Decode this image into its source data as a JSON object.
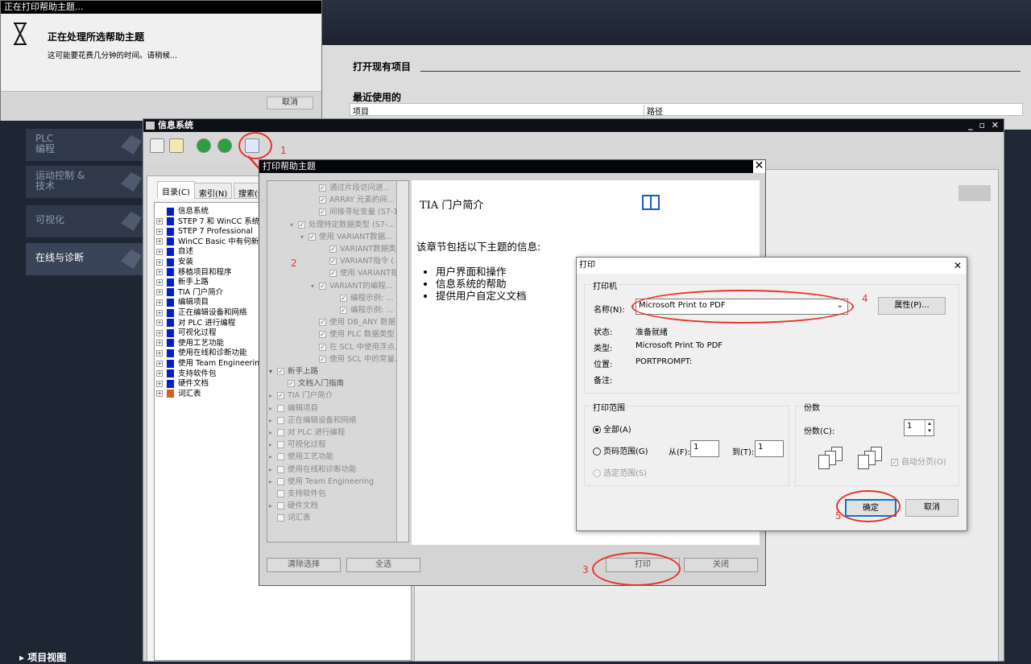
{
  "busy_dialog": {
    "title": "正在打印帮助主题...",
    "heading": "正在处理所选帮助主题",
    "message": "这可能要花费几分钟的时间。请稍候...",
    "cancel": "取消"
  },
  "tia": {
    "nav": [
      {
        "label": "PLC\n编程"
      },
      {
        "label": "运动控制 &\n技术"
      },
      {
        "label": "可视化"
      },
      {
        "label": "在线与诊断"
      }
    ],
    "project_view": "▸ 项目视图",
    "open_project": "打开现有项目",
    "recent": "最近使用的",
    "col_project": "项目",
    "col_path": "路径"
  },
  "info": {
    "title": "信息系统",
    "win_ctrl": "_ ▫ ✕",
    "tabs": [
      "目录(C)",
      "索引(N)",
      "搜索(S"
    ],
    "tree": [
      {
        "label": "信息系统",
        "top": true
      },
      {
        "label": "STEP 7 和 WinCC 系统"
      },
      {
        "label": "STEP 7 Professional"
      },
      {
        "label": "WinCC Basic 中有何新"
      },
      {
        "label": "自述"
      },
      {
        "label": "安装"
      },
      {
        "label": "移植项目和程序"
      },
      {
        "label": "新手上路"
      },
      {
        "label": "TIA 门户简介"
      },
      {
        "label": "编辑项目"
      },
      {
        "label": "正在编辑设备和网络"
      },
      {
        "label": "对 PLC 进行编程"
      },
      {
        "label": "可视化过程"
      },
      {
        "label": "使用工艺功能"
      },
      {
        "label": "使用在线和诊断功能"
      },
      {
        "label": "使用 Team Engineerin"
      },
      {
        "label": "支持软件包"
      },
      {
        "label": "硬件文档"
      },
      {
        "label": "词汇表"
      }
    ]
  },
  "print_help": {
    "title": "打印帮助主题",
    "tree": [
      {
        "label": "通过片段访问进...",
        "ind": 4
      },
      {
        "label": "ARRAY 元素的间...",
        "ind": 4
      },
      {
        "label": "间接寻址变量 (S7-1...",
        "ind": 4
      },
      {
        "label": "处理特定数据类型 (S7-...",
        "ind": 2,
        "arrow": "▾"
      },
      {
        "label": "使用 VARIANT数据...",
        "ind": 3,
        "arrow": "▾"
      },
      {
        "label": "VARIANT数据类...",
        "ind": 5
      },
      {
        "label": "VARIANT指令 (...",
        "ind": 5
      },
      {
        "label": "使用 VARIANT指...",
        "ind": 5
      },
      {
        "label": "VARIANT的编程...",
        "ind": 4,
        "arrow": "▾"
      },
      {
        "label": "编程示例: ...",
        "ind": 6
      },
      {
        "label": "编程示例: ...",
        "ind": 6
      },
      {
        "label": "使用 DB_ANY 数据...",
        "ind": 4
      },
      {
        "label": "使用 PLC 数据类型 (...",
        "ind": 4
      },
      {
        "label": "在 SCL 中使用浮点...",
        "ind": 4
      },
      {
        "label": "使用 SCL 中的常量...",
        "ind": 4
      },
      {
        "label": "新手上路",
        "ind": 0,
        "arrow": "▾",
        "dark": true
      },
      {
        "label": "文档入门指南",
        "ind": 1,
        "dark": true
      },
      {
        "label": "TIA 门户简介",
        "ind": 0,
        "arrow": "▸"
      },
      {
        "label": "编辑项目",
        "ind": 0,
        "arrow": "▸",
        "off": true
      },
      {
        "label": "正在编辑设备和网络",
        "ind": 0,
        "arrow": "▸",
        "off": true
      },
      {
        "label": "对 PLC 进行编程",
        "ind": 0,
        "arrow": "▸",
        "off": true
      },
      {
        "label": "可视化过程",
        "ind": 0,
        "arrow": "▸",
        "off": true
      },
      {
        "label": "使用工艺功能",
        "ind": 0,
        "arrow": "▸",
        "off": true
      },
      {
        "label": "使用在线和诊断功能",
        "ind": 0,
        "arrow": "▸",
        "off": true
      },
      {
        "label": "使用 Team Engineering",
        "ind": 0,
        "arrow": "▸",
        "off": true
      },
      {
        "label": "支持软件包",
        "ind": 0,
        "off": true
      },
      {
        "label": "硬件文档",
        "ind": 0,
        "arrow": "▸",
        "off": true
      },
      {
        "label": "词汇表",
        "ind": 0,
        "off": true
      }
    ],
    "doc_title": "TIA 门户简介",
    "doc_intro": "该章节包括以下主题的信息:",
    "doc_items": [
      "用户界面和操作",
      "信息系统的帮助",
      "提供用户自定义文档"
    ],
    "clear_sel": "清除选择",
    "select_all": "全选",
    "print": "打印",
    "close": "关闭"
  },
  "print_dialog": {
    "title": "打印",
    "printer_group": "打印机",
    "name_label": "名称(N):",
    "name_value": "Microsoft Print to PDF",
    "properties": "属性(P)...",
    "status_label": "状态:",
    "status_value": "准备就绪",
    "type_label": "类型:",
    "type_value": "Microsoft Print To PDF",
    "where_label": "位置:",
    "where_value": "PORTPROMPT:",
    "comment_label": "备注:",
    "range_group": "打印范围",
    "all": "全部(A)",
    "pages": "页码范围(G)",
    "from_label": "从(F):",
    "from_value": "1",
    "to_label": "到(T):",
    "to_value": "1",
    "selection": "选定范围(S)",
    "copies_group": "份数",
    "copies_label": "份数(C):",
    "copies_value": "1",
    "collate": "自动分页(O)",
    "ok": "确定",
    "cancel": "取消"
  },
  "annotations": [
    "1",
    "2",
    "3",
    "4",
    "5"
  ],
  "colors": {
    "annotation": "#e8332a",
    "title_bar": "#05060a"
  }
}
